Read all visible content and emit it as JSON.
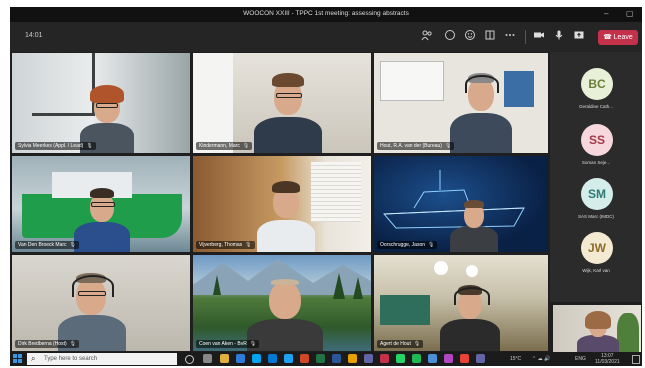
{
  "window": {
    "title": "WOOCON XXIII - TPPC 1st meeting: assessing abstracts",
    "minimize_glyph": "–",
    "maximize_glyph": "▢"
  },
  "toolbar": {
    "time": "14:01",
    "icons": [
      "people-icon",
      "chat-icon",
      "reactions-icon",
      "rooms-icon",
      "more-icon",
      "camera-icon",
      "mic-icon",
      "share-icon"
    ],
    "leave_label": "Leave",
    "leave_color": "#c4314b"
  },
  "participants": [
    {
      "name": "Sylvia Meerkes (Appl. / Lead)",
      "mic": "🎙"
    },
    {
      "name": "Kindermann, Marc",
      "mic": "🎙"
    },
    {
      "name": "Hout, R.A. van der (Bureau)",
      "mic": "🎙"
    },
    {
      "name": "Van Den Broeck Marc",
      "mic": "🎙"
    },
    {
      "name": "Vijverberg, Thomas",
      "mic": "🎙"
    },
    {
      "name": "Oorschrugge, Jason",
      "mic": "🎙"
    },
    {
      "name": "Dirk Bredberna (Host)",
      "mic": "🎙"
    },
    {
      "name": "Coen van Aken - BvR",
      "mic": "🎙"
    },
    {
      "name": "Agert de Hout",
      "mic": "🎙"
    }
  ],
  "roster": [
    {
      "initials": "BC",
      "name": "Geraldine Cath...",
      "color": "#e8f0d8",
      "text": "#6b7d3a"
    },
    {
      "initials": "SS",
      "name": "Soman Seje...",
      "color": "#f6d8dc",
      "text": "#a4384a"
    },
    {
      "initials": "SM",
      "name": "SAS Marc (IMDC)",
      "color": "#d4ecea",
      "text": "#2f7a72"
    },
    {
      "initials": "JW",
      "name": "Wijk, Karl van",
      "color": "#f4ead2",
      "text": "#8b6b2a"
    }
  ],
  "taskbar": {
    "search_placeholder": "Type here to search",
    "weather": "15°C",
    "lang": "ENG",
    "clock_time": "13:07",
    "clock_date": "11/03/2021"
  }
}
